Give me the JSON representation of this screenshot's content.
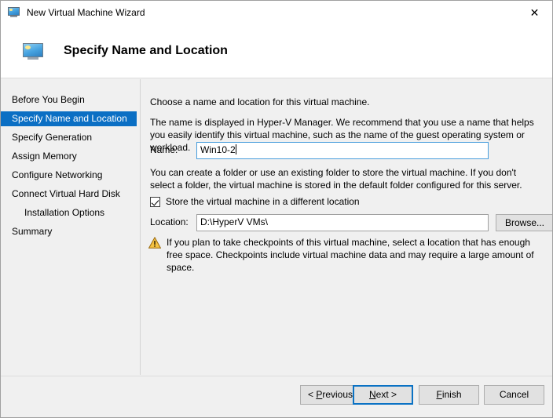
{
  "window": {
    "title": "New Virtual Machine Wizard",
    "title_icon": "virtual-machine-monitor-icon",
    "close_label": "✕"
  },
  "header": {
    "title": "Specify Name and Location",
    "icon": "virtual-machine-monitor-icon"
  },
  "sidebar": {
    "items": [
      {
        "label": "Before You Begin",
        "selected": false,
        "indent": false
      },
      {
        "label": "Specify Name and Location",
        "selected": true,
        "indent": false
      },
      {
        "label": "Specify Generation",
        "selected": false,
        "indent": false
      },
      {
        "label": "Assign Memory",
        "selected": false,
        "indent": false
      },
      {
        "label": "Configure Networking",
        "selected": false,
        "indent": false
      },
      {
        "label": "Connect Virtual Hard Disk",
        "selected": false,
        "indent": false
      },
      {
        "label": "Installation Options",
        "selected": false,
        "indent": true
      },
      {
        "label": "Summary",
        "selected": false,
        "indent": false
      }
    ],
    "selection_color": "#0b6fc4"
  },
  "content": {
    "intro": "Choose a name and location for this virtual machine.",
    "name_description": "The name is displayed in Hyper-V Manager. We recommend that you use a name that helps you easily identify this virtual machine, such as the name of the guest operating system or workload.",
    "name_label": "Name:",
    "name_value": "Win10-2",
    "name_placeholder": "",
    "folder_description": "You can create a folder or use an existing folder to store the virtual machine. If you don't select a folder, the virtual machine is stored in the default folder configured for this server.",
    "store_checkbox_label": "Store the virtual machine in a different location",
    "store_checkbox_checked": true,
    "location_label": "Location:",
    "location_value": "D:\\HyperV VMs\\",
    "location_placeholder": "",
    "browse_label": "Browse...",
    "warning_icon": "warning-triangle-icon",
    "warning_text": "If you plan to take checkpoints of this virtual machine, select a location that has enough free space. Checkpoints include virtual machine data and may require a large amount of space."
  },
  "footer": {
    "previous_label": "< Previous",
    "next_label": "Next >",
    "finish_label": "Finish",
    "cancel_label": "Cancel",
    "default_button": "next",
    "focus_color": "#0b72c4"
  }
}
